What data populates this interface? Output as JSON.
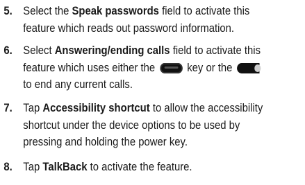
{
  "steps": [
    {
      "number": "5.",
      "line1_pre": "Select the ",
      "line1_bold": "Speak passwords",
      "line1_post": " field to activate this",
      "line2": "feature which reads out password information."
    },
    {
      "number": "6.",
      "line1_pre": "Select ",
      "line1_bold": "Answering/ending calls",
      "line1_post": " field to activate this",
      "line2_pre": "feature which uses either the ",
      "line2_mid": " key or the ",
      "line3": "to end any current calls."
    },
    {
      "number": "7.",
      "line1_pre": "Tap ",
      "line1_bold": "Accessibility shortcut",
      "line1_post": " to allow the accessibility",
      "line2": "shortcut under the device options to be used by",
      "line3": "pressing and holding the power key."
    },
    {
      "number": "8.",
      "line1_pre": "Tap ",
      "line1_bold": "TalkBack",
      "line1_post": " to activate the feature."
    }
  ],
  "icons": [
    "home-key-icon",
    "power-key-icon"
  ]
}
